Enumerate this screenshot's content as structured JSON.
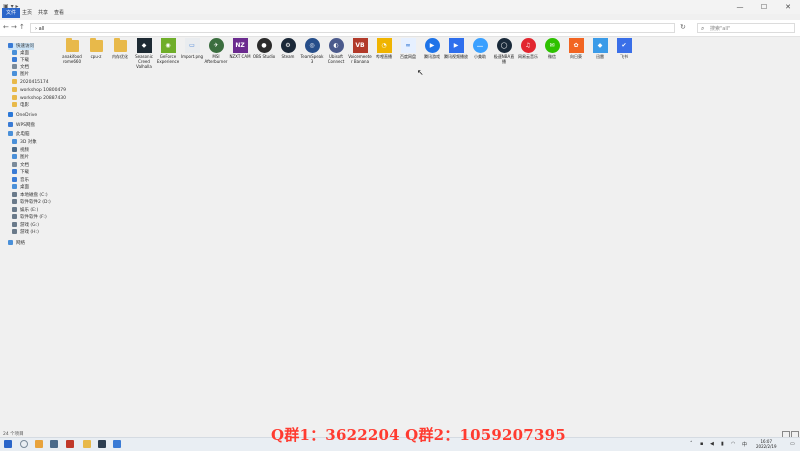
{
  "ribbon": {
    "tabs": [
      "文件",
      "主页",
      "共享",
      "查看"
    ]
  },
  "address": {
    "path": "› all",
    "search_placeholder": "搜索\"all\""
  },
  "sidebar": {
    "items": [
      {
        "label": "快速访问",
        "icon": "star-icon",
        "color": "#3a7bd5"
      },
      {
        "label": "桌面",
        "icon": "desktop-icon",
        "color": "#4a90d9"
      },
      {
        "label": "下载",
        "icon": "download-icon",
        "color": "#3a7bd5"
      },
      {
        "label": "文档",
        "icon": "document-icon",
        "color": "#7a8a9a"
      },
      {
        "label": "图片",
        "icon": "picture-icon",
        "color": "#4a90d9"
      },
      {
        "label": "2020415174",
        "icon": "folder-icon",
        "color": "#e8b94a"
      },
      {
        "label": "workshop 10800479",
        "icon": "folder-icon",
        "color": "#e8b94a"
      },
      {
        "label": "workshop 20887430",
        "icon": "folder-icon",
        "color": "#e8b94a"
      },
      {
        "label": "电影",
        "icon": "folder-icon",
        "color": "#e8b94a"
      },
      {
        "label": "OneDrive",
        "icon": "cloud-icon",
        "color": "#2b78d8"
      },
      {
        "label": "WPS网盘",
        "icon": "cloud-icon",
        "color": "#3a7bd5"
      },
      {
        "label": "此电脑",
        "icon": "computer-icon",
        "color": "#4a90d9"
      },
      {
        "label": "3D 对象",
        "icon": "cube-icon",
        "color": "#4a90d9"
      },
      {
        "label": "视频",
        "icon": "video-icon",
        "color": "#4a6a8a"
      },
      {
        "label": "图片",
        "icon": "picture-icon",
        "color": "#4a90d9"
      },
      {
        "label": "文档",
        "icon": "document-icon",
        "color": "#7a8a9a"
      },
      {
        "label": "下载",
        "icon": "download-icon",
        "color": "#3a7bd5"
      },
      {
        "label": "音乐",
        "icon": "music-icon",
        "color": "#3a7bd5"
      },
      {
        "label": "桌面",
        "icon": "desktop-icon",
        "color": "#4a90d9"
      },
      {
        "label": "本地磁盘 (C:)",
        "icon": "drive-icon",
        "color": "#6a7a8a"
      },
      {
        "label": "软件软件2 (D:)",
        "icon": "drive-icon",
        "color": "#6a7a8a"
      },
      {
        "label": "娱乐 (E:)",
        "icon": "drive-icon",
        "color": "#6a7a8a"
      },
      {
        "label": "软件软件 (F:)",
        "icon": "drive-icon",
        "color": "#6a7a8a"
      },
      {
        "label": "游戏 (G:)",
        "icon": "drive-icon",
        "color": "#6a7a8a"
      },
      {
        "label": "游戏 (H:)",
        "icon": "drive-icon",
        "color": "#6a7a8a"
      },
      {
        "label": "网络",
        "icon": "network-icon",
        "color": "#4a90d9"
      }
    ]
  },
  "files": [
    {
      "label": "anakifood rome660",
      "icon": "folder-icon",
      "kind": "folder",
      "color": "#e8b94a",
      "glyph": ""
    },
    {
      "label": "cpu-z",
      "icon": "folder-icon",
      "kind": "folder",
      "color": "#e8b94a",
      "glyph": ""
    },
    {
      "label": "内存优化",
      "icon": "folder-icon",
      "kind": "folder",
      "color": "#e8b94a",
      "glyph": ""
    },
    {
      "label": "Seasonic Creed Valhalla",
      "icon": "game-icon",
      "kind": "square",
      "color": "#1d2a33",
      "glyph": "◆"
    },
    {
      "label": "GeForce Experience",
      "icon": "nvidia-icon",
      "kind": "square",
      "color": "#6fae2a",
      "glyph": "◉"
    },
    {
      "label": "Import.png",
      "icon": "image-file-icon",
      "kind": "square",
      "color": "#e9ecef",
      "glyph": "▭"
    },
    {
      "label": "MSI Afterburner",
      "icon": "msi-afterburner-icon",
      "kind": "round",
      "color": "#3b6e3f",
      "glyph": "✈"
    },
    {
      "label": "NZXT CAM",
      "icon": "nzxt-cam-icon",
      "kind": "square",
      "color": "#6b2b8f",
      "glyph": "NZ"
    },
    {
      "label": "OBS Studio",
      "icon": "obs-icon",
      "kind": "round",
      "color": "#2b2b2b",
      "glyph": "●"
    },
    {
      "label": "Steam",
      "icon": "steam-icon",
      "kind": "round",
      "color": "#1b2838",
      "glyph": "⚙"
    },
    {
      "label": "TeamSpeak 3",
      "icon": "teamspeak-icon",
      "kind": "round",
      "color": "#264e8a",
      "glyph": "◎"
    },
    {
      "label": "Ubisoft Connect",
      "icon": "ubisoft-icon",
      "kind": "round",
      "color": "#4b5a8c",
      "glyph": "◐"
    },
    {
      "label": "Voicemeeter Banana",
      "icon": "voicemeeter-icon",
      "kind": "square",
      "color": "#b23a2a",
      "glyph": "VB"
    },
    {
      "label": "哔哩直播",
      "icon": "bilibili-live-icon",
      "kind": "square",
      "color": "#f0b400",
      "glyph": "◔"
    },
    {
      "label": "百度网盘",
      "icon": "baidu-netdisk-icon",
      "kind": "square",
      "color": "#e6f0ff",
      "glyph": "∞"
    },
    {
      "label": "腾讯游戏",
      "icon": "tencent-games-icon",
      "kind": "round",
      "color": "#1e73e8",
      "glyph": "▶"
    },
    {
      "label": "腾讯视频播放",
      "icon": "tencent-video-icon",
      "kind": "square",
      "color": "#2f6fed",
      "glyph": "▶"
    },
    {
      "label": "小美助",
      "icon": "chat-bubble-icon",
      "kind": "round",
      "color": "#3aa0ff",
      "glyph": "…"
    },
    {
      "label": "极速NBA直播",
      "icon": "nba-icon",
      "kind": "round",
      "color": "#1a2a3a",
      "glyph": "◯"
    },
    {
      "label": "网易云音乐",
      "icon": "netease-music-icon",
      "kind": "round",
      "color": "#e2262f",
      "glyph": "♫"
    },
    {
      "label": "微信",
      "icon": "wechat-icon",
      "kind": "round",
      "color": "#2dc100",
      "glyph": "✉"
    },
    {
      "label": "向日葵",
      "icon": "sunflower-icon",
      "kind": "square",
      "color": "#f26522",
      "glyph": "✿"
    },
    {
      "label": "迅雷",
      "icon": "thunder-icon",
      "kind": "square",
      "color": "#3b9be8",
      "glyph": "◆"
    },
    {
      "label": "飞书",
      "icon": "feishu-icon",
      "kind": "square",
      "color": "#3a6fe8",
      "glyph": "✔"
    }
  ],
  "status": {
    "item_count": "24 个项目"
  },
  "taskbar": {
    "apps": [
      {
        "icon": "windows-start-icon",
        "color": "#2b66c9"
      },
      {
        "icon": "search-icon",
        "color": "#7a8a9a"
      },
      {
        "icon": "chrome-icon",
        "color": "#e8a33d"
      },
      {
        "icon": "task-view-icon",
        "color": "#4a6a8a"
      },
      {
        "icon": "media-app-icon",
        "color": "#c0392b"
      },
      {
        "icon": "file-explorer-icon",
        "color": "#e8b94a"
      },
      {
        "icon": "terminal-icon",
        "color": "#2d3e50"
      },
      {
        "icon": "app-icon",
        "color": "#3a7bd5"
      }
    ],
    "time": "16:07",
    "date": "2022/2/19"
  },
  "watermark": "Q群1：3622204 Q群2：1059207395"
}
